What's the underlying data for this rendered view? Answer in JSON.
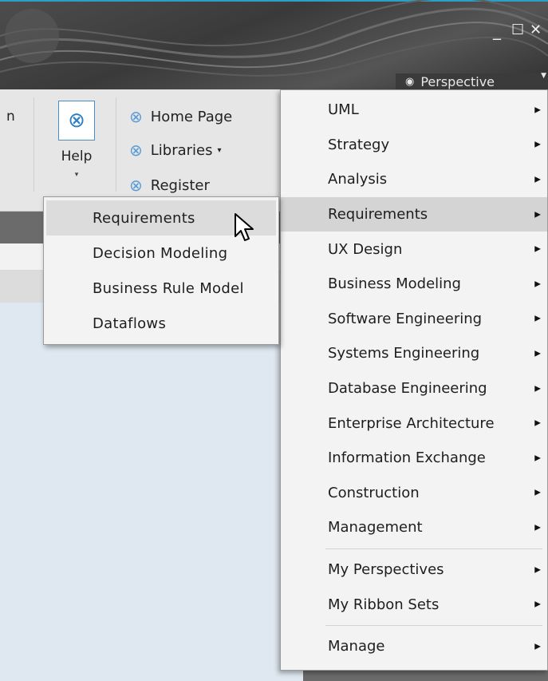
{
  "window": {
    "minimize_glyph": "_",
    "maximize_glyph": "☐",
    "close_glyph": "✕",
    "perspective_label": "Perspective",
    "perspective_icon": "eye-icon"
  },
  "ribbon": {
    "cut_label": "n",
    "help_label": "Help",
    "help_caret": "▾",
    "links": [
      {
        "label": "Home Page",
        "icon": "globe-icon"
      },
      {
        "label": "Libraries",
        "icon": "globe-icon",
        "caret": "▾"
      },
      {
        "label": "Register",
        "icon": "globe-icon"
      }
    ]
  },
  "submenu": {
    "items": [
      {
        "label": "Requirements",
        "highlighted": true
      },
      {
        "label": "Decision Modeling",
        "highlighted": false
      },
      {
        "label": "Business Rule Model",
        "highlighted": false
      },
      {
        "label": "Dataflows",
        "highlighted": false
      }
    ]
  },
  "menu": {
    "group1": [
      {
        "label": "UML"
      },
      {
        "label": "Strategy"
      },
      {
        "label": "Analysis"
      },
      {
        "label": "Requirements",
        "highlighted": true
      },
      {
        "label": "UX Design"
      },
      {
        "label": "Business Modeling"
      },
      {
        "label": "Software Engineering"
      },
      {
        "label": "Systems Engineering"
      },
      {
        "label": "Database Engineering"
      },
      {
        "label": "Enterprise Architecture"
      },
      {
        "label": "Information Exchange"
      },
      {
        "label": "Construction"
      },
      {
        "label": "Management"
      }
    ],
    "group2": [
      {
        "label": "My Perspectives"
      },
      {
        "label": "My Ribbon Sets"
      }
    ],
    "group3": [
      {
        "label": "Manage"
      }
    ],
    "arrow_glyph": "▶"
  },
  "colors": {
    "accent": "#2aa0c8",
    "menu_bg": "#f3f3f3",
    "highlight": "#d4d4d4"
  }
}
